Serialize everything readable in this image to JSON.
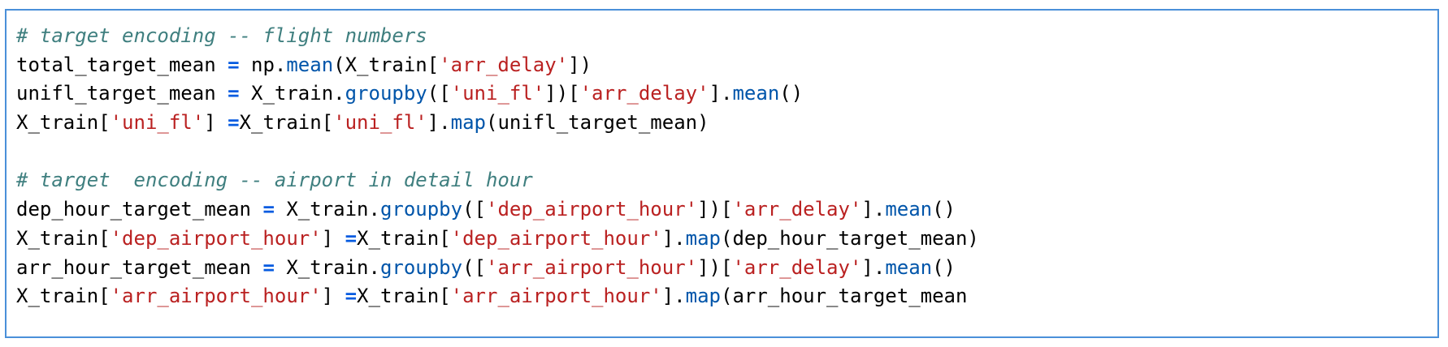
{
  "colors": {
    "border": "#4a90d9",
    "comment": "#3f7f7f",
    "string": "#ba2121",
    "operator": "#055be0",
    "function": "#0055aa",
    "text": "#000000"
  },
  "code_lines": [
    [
      {
        "t": "comment",
        "v": "# target encoding -- flight numbers"
      }
    ],
    [
      {
        "t": "plain",
        "v": "total_target_mean "
      },
      {
        "t": "op",
        "v": "="
      },
      {
        "t": "plain",
        "v": " np."
      },
      {
        "t": "fn",
        "v": "mean"
      },
      {
        "t": "plain",
        "v": "(X_train["
      },
      {
        "t": "str",
        "v": "'arr_delay'"
      },
      {
        "t": "plain",
        "v": "])"
      }
    ],
    [
      {
        "t": "plain",
        "v": "unifl_target_mean "
      },
      {
        "t": "op",
        "v": "="
      },
      {
        "t": "plain",
        "v": " X_train."
      },
      {
        "t": "fn",
        "v": "groupby"
      },
      {
        "t": "plain",
        "v": "(["
      },
      {
        "t": "str",
        "v": "'uni_fl'"
      },
      {
        "t": "plain",
        "v": "])["
      },
      {
        "t": "str",
        "v": "'arr_delay'"
      },
      {
        "t": "plain",
        "v": "]."
      },
      {
        "t": "fn",
        "v": "mean"
      },
      {
        "t": "plain",
        "v": "()"
      }
    ],
    [
      {
        "t": "plain",
        "v": "X_train["
      },
      {
        "t": "str",
        "v": "'uni_fl'"
      },
      {
        "t": "plain",
        "v": "] "
      },
      {
        "t": "op",
        "v": "="
      },
      {
        "t": "plain",
        "v": "X_train["
      },
      {
        "t": "str",
        "v": "'uni_fl'"
      },
      {
        "t": "plain",
        "v": "]."
      },
      {
        "t": "fn",
        "v": "map"
      },
      {
        "t": "plain",
        "v": "(unifl_target_mean)"
      }
    ],
    [],
    [
      {
        "t": "comment",
        "v": "# target  encoding -- airport in detail hour"
      }
    ],
    [
      {
        "t": "plain",
        "v": "dep_hour_target_mean "
      },
      {
        "t": "op",
        "v": "="
      },
      {
        "t": "plain",
        "v": " X_train."
      },
      {
        "t": "fn",
        "v": "groupby"
      },
      {
        "t": "plain",
        "v": "(["
      },
      {
        "t": "str",
        "v": "'dep_airport_hour'"
      },
      {
        "t": "plain",
        "v": "])["
      },
      {
        "t": "str",
        "v": "'arr_delay'"
      },
      {
        "t": "plain",
        "v": "]."
      },
      {
        "t": "fn",
        "v": "mean"
      },
      {
        "t": "plain",
        "v": "()"
      }
    ],
    [
      {
        "t": "plain",
        "v": "X_train["
      },
      {
        "t": "str",
        "v": "'dep_airport_hour'"
      },
      {
        "t": "plain",
        "v": "] "
      },
      {
        "t": "op",
        "v": "="
      },
      {
        "t": "plain",
        "v": "X_train["
      },
      {
        "t": "str",
        "v": "'dep_airport_hour'"
      },
      {
        "t": "plain",
        "v": "]."
      },
      {
        "t": "fn",
        "v": "map"
      },
      {
        "t": "plain",
        "v": "(dep_hour_target_mean)"
      }
    ],
    [
      {
        "t": "plain",
        "v": "arr_hour_target_mean "
      },
      {
        "t": "op",
        "v": "="
      },
      {
        "t": "plain",
        "v": " X_train."
      },
      {
        "t": "fn",
        "v": "groupby"
      },
      {
        "t": "plain",
        "v": "(["
      },
      {
        "t": "str",
        "v": "'arr_airport_hour'"
      },
      {
        "t": "plain",
        "v": "])["
      },
      {
        "t": "str",
        "v": "'arr_delay'"
      },
      {
        "t": "plain",
        "v": "]."
      },
      {
        "t": "fn",
        "v": "mean"
      },
      {
        "t": "plain",
        "v": "()"
      }
    ],
    [
      {
        "t": "plain",
        "v": "X_train["
      },
      {
        "t": "str",
        "v": "'arr_airport_hour'"
      },
      {
        "t": "plain",
        "v": "] "
      },
      {
        "t": "op",
        "v": "="
      },
      {
        "t": "plain",
        "v": "X_train["
      },
      {
        "t": "str",
        "v": "'arr_airport_hour'"
      },
      {
        "t": "plain",
        "v": "]."
      },
      {
        "t": "fn",
        "v": "map"
      },
      {
        "t": "plain",
        "v": "(arr_hour_target_mean"
      }
    ]
  ]
}
